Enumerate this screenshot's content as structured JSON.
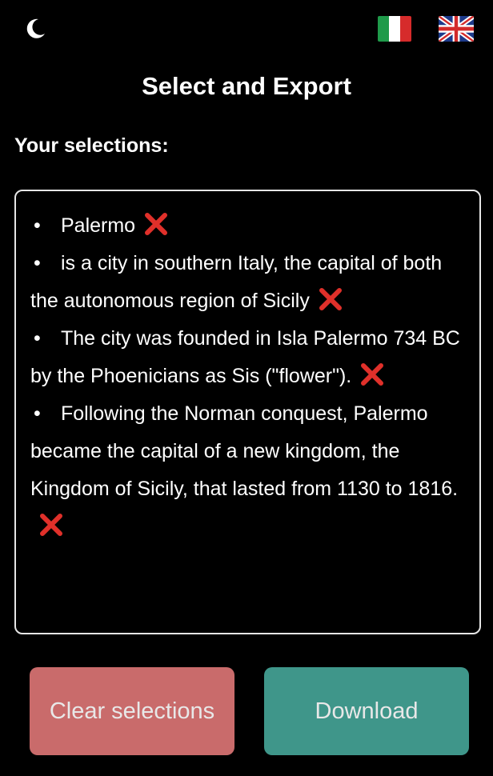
{
  "header": {
    "theme_toggle_icon": "moon-icon",
    "languages": [
      {
        "code": "it",
        "icon": "italy-flag-icon"
      },
      {
        "code": "en",
        "icon": "uk-flag-icon"
      }
    ]
  },
  "main": {
    "title": "Select and Export",
    "selections_heading": "Your selections:",
    "selections": [
      {
        "text": "Palermo"
      },
      {
        "text": "is a city in southern Italy, the capital of both the autonomous region of Sicily"
      },
      {
        "text": "The city was founded in Isla Palermo 734 BC by the Phoenicians as Sis (\"flower\")."
      },
      {
        "text": "Following the Norman conquest, Palermo became the capital of a new kingdom, the Kingdom of Sicily, that lasted from 1130 to 1816."
      }
    ],
    "bullet_char": "•",
    "remove_icon": "close-icon"
  },
  "actions": {
    "clear_label": "Clear selections",
    "download_label": "Download"
  },
  "colors": {
    "background": "#000000",
    "clear_button": "#c96b6b",
    "download_button": "#3f968a",
    "remove_x": "#e0302a"
  }
}
